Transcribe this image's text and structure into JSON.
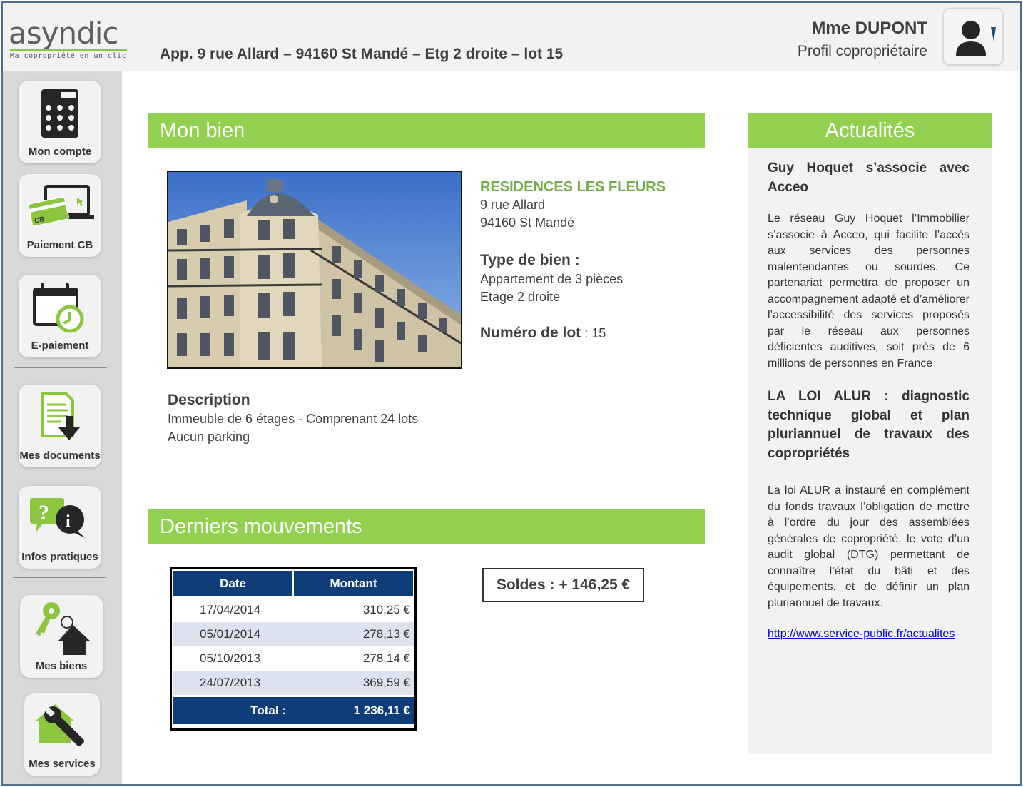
{
  "header": {
    "logo_word": "asyndic",
    "logo_tagline": "Ma copropriété en un clic",
    "address": "App. 9 rue Allard – 94160 St Mandé – Etg 2 droite – lot 15",
    "user_name": "Mme DUPONT",
    "user_role": "Profil copropriétaire"
  },
  "sidebar": {
    "items": [
      {
        "label": "Mon compte",
        "icon": "calculator-icon"
      },
      {
        "label": "Paiement CB",
        "icon": "credit-card-laptop-icon"
      },
      {
        "label": "E-paiement",
        "icon": "calendar-clock-icon"
      },
      {
        "label": "Mes documents",
        "icon": "document-download-icon"
      },
      {
        "label": "Infos pratiques",
        "icon": "question-info-bubbles-icon"
      },
      {
        "label": "Mes biens",
        "icon": "key-house-icon"
      },
      {
        "label": "Mes services",
        "icon": "house-wrench-icon"
      }
    ]
  },
  "bien": {
    "section_title": "Mon bien",
    "residence": "RESIDENCES LES FLEURS",
    "street": "9 rue Allard",
    "city": "94160 St Mandé",
    "type_label": "Type de bien :",
    "type_line1": "Appartement de 3 pièces",
    "type_line2": "Etage 2 droite",
    "lot_label": "Numéro de lot",
    "lot_value": " : 15",
    "description_label": "Description",
    "description_line1": "Immeuble de 6 étages - Comprenant 24 lots",
    "description_line2": "Aucun parking"
  },
  "mouvements": {
    "section_title": "Derniers mouvements",
    "headers": {
      "date": "Date",
      "montant": "Montant"
    },
    "rows": [
      {
        "date": "17/04/2014",
        "montant": "310,25 €"
      },
      {
        "date": "05/01/2014",
        "montant": "278,13 €"
      },
      {
        "date": "05/10/2013",
        "montant": "278,14 €"
      },
      {
        "date": "24/07/2013",
        "montant": "369,59 €"
      }
    ],
    "total_label": "Total :",
    "total_value": "1 236,11 €",
    "solde": "Soldes : + 146,25 €"
  },
  "news": {
    "section_title": "Actualités",
    "item1_title": "Guy Hoquet s’associe avec Acceo",
    "item1_text": "Le réseau Guy Hoquet l’Immobilier s’associe à Acceo, qui facilite l’accès aux services des personnes malentendantes ou sourdes. Ce partenariat permettra de proposer un accompagnement adapté et d’améliorer l’accessibilité des services proposés par le réseau aux personnes déficientes auditives, soit près de 6 millions de personnes en France",
    "item2_title": "LA LOI ALUR : diagnostic technique global et plan pluriannuel de travaux des copropriétés",
    "item2_text": "La loi ALUR a instauré en complément du fonds travaux l’obligation de mettre à l’ordre du jour des assemblées générales de copropriété, le vote d’un audit global (DTG) permettant de connaître l’état du bâti et des équipements, et de définir un plan pluriannuel de travaux.",
    "link": "http://www.service-public.fr/actualites"
  },
  "colors": {
    "green": "#92d050",
    "dark_green_text": "#70ad47",
    "navy": "#0e3d7a",
    "frame_border": "#4f6d8f"
  }
}
